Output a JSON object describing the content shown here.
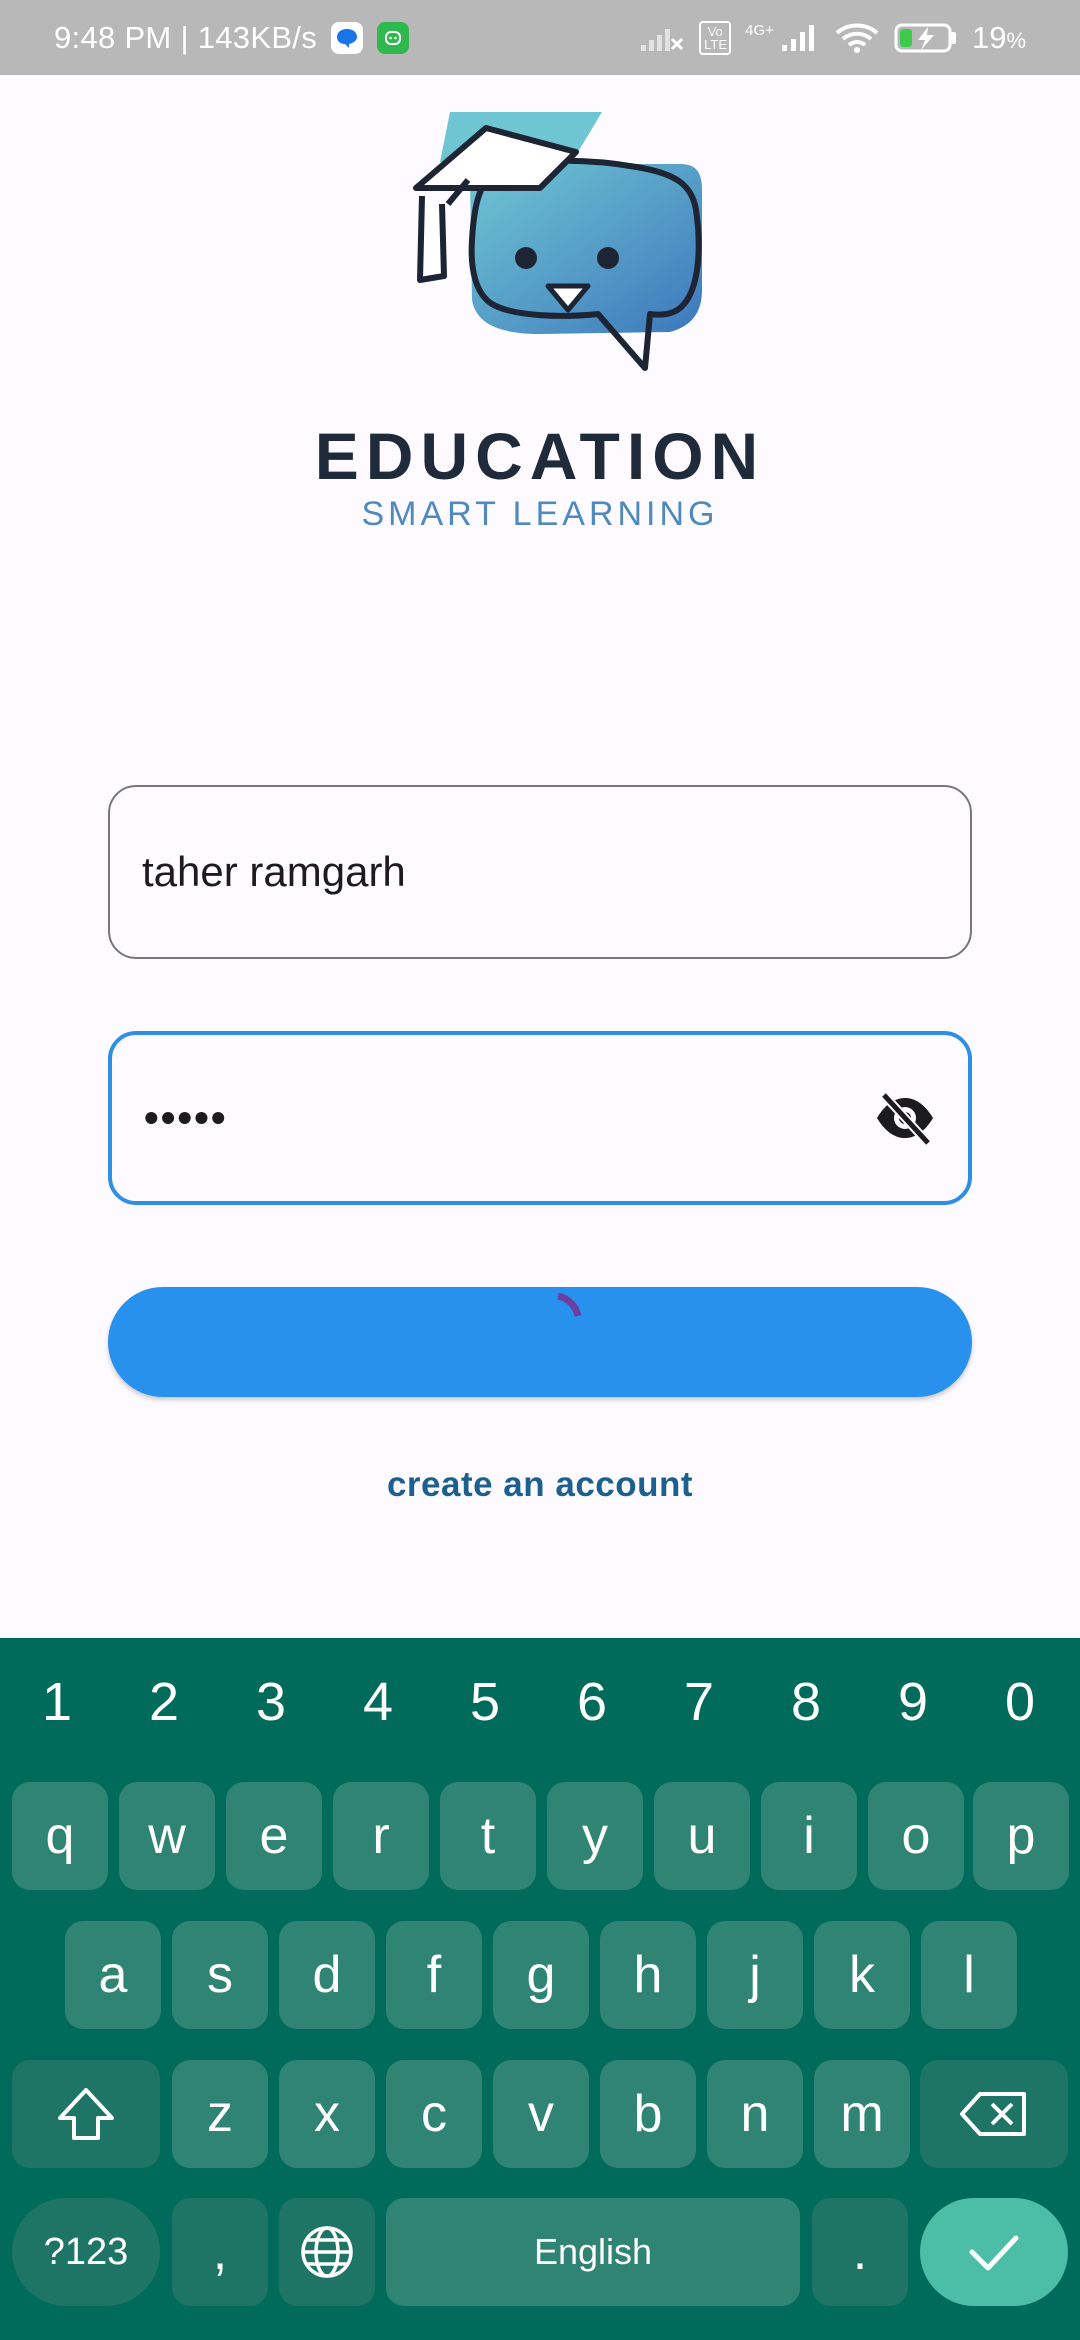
{
  "status_bar": {
    "time_speed": "9:48 PM | 143KB/s",
    "volte": "Vo LTE",
    "network": "4G+",
    "battery": "19",
    "battery_unit": "%"
  },
  "brand": {
    "title": "EDUCATION",
    "subtitle": "SMART LEARNING"
  },
  "login_form": {
    "username_value": "taher ramgarh",
    "password_masked": "•••••",
    "password_visibility_icon": "visibility-off-icon",
    "login_loading": true
  },
  "links": {
    "create_account": "create an account"
  },
  "keyboard": {
    "number_row": [
      "1",
      "2",
      "3",
      "4",
      "5",
      "6",
      "7",
      "8",
      "9",
      "0"
    ],
    "row1": [
      "q",
      "w",
      "e",
      "r",
      "t",
      "y",
      "u",
      "i",
      "o",
      "p"
    ],
    "row2": [
      "a",
      "s",
      "d",
      "f",
      "g",
      "h",
      "j",
      "k",
      "l"
    ],
    "row3": [
      "z",
      "x",
      "c",
      "v",
      "b",
      "n",
      "m"
    ],
    "symbols_label": "?123",
    "comma": ",",
    "space_label": "English",
    "period": "."
  },
  "colors": {
    "primary": "#2891ee",
    "link": "#1d5f8e",
    "keyboard_bg": "#006b5b",
    "key_bg": "#2f8474",
    "enter_key": "#4cbda7"
  }
}
